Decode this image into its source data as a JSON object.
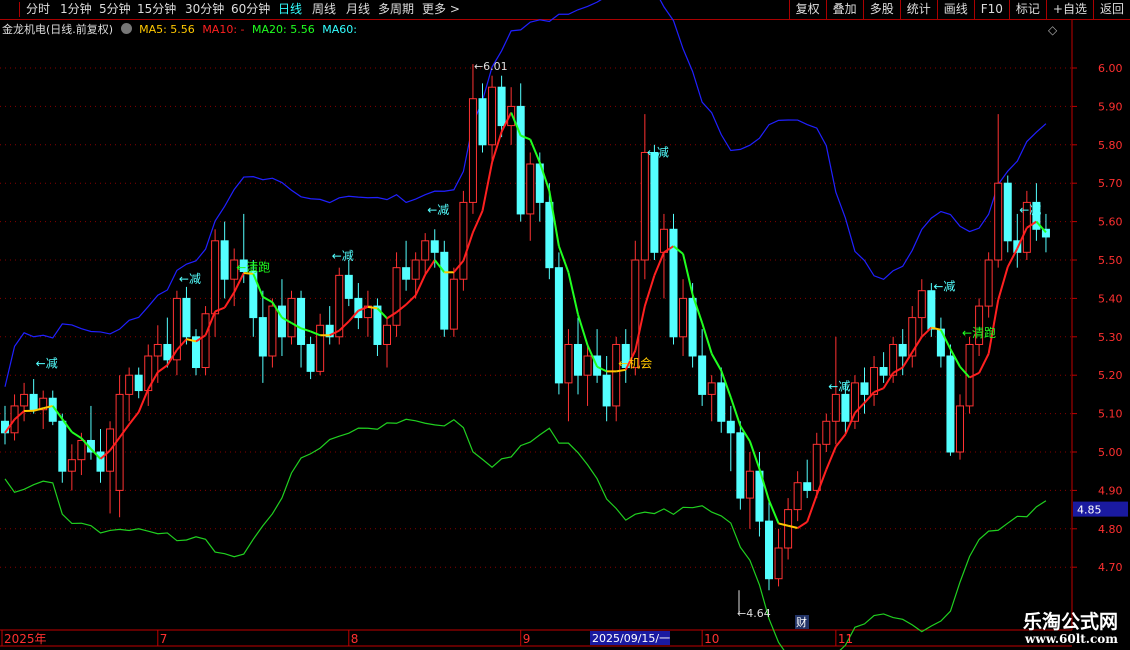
{
  "toolbar": {
    "periods": [
      "分时",
      "1分钟",
      "5分钟",
      "15分钟",
      "30分钟",
      "60分钟",
      "日线",
      "周线",
      "月线",
      "多周期",
      "更多 >"
    ],
    "active": "日线",
    "buttons": [
      "复权",
      "叠加",
      "多股",
      "统计",
      "画线",
      "F10",
      "标记",
      "+自选",
      "返回"
    ]
  },
  "legend": {
    "title": "金龙机电(日线.前复权)",
    "ma5": "MA5: 5.56",
    "ma10": "MA10: -",
    "ma20": "MA20: 5.56",
    "ma60": "MA60:"
  },
  "colors": {
    "up": "#ff3232",
    "down": "#54ffff",
    "upper_band": "#2020ff",
    "lower_band": "#20d020",
    "axis": "#c00000",
    "ma_up": "#ff2020",
    "ma_down": "#20ff20",
    "ma_flat": "#ffc800"
  },
  "chart_data": {
    "type": "candlestick",
    "ylim": [
      4.62,
      6.08
    ],
    "yticks": [
      "6.00",
      "5.90",
      "5.80",
      "5.70",
      "5.60",
      "5.50",
      "5.40",
      "5.30",
      "5.20",
      "5.10",
      "5.00",
      "4.90",
      "4.80",
      "4.70"
    ],
    "current_price": "4.85",
    "high_label": "6.01",
    "low_label": "4.64",
    "x_labels": [
      {
        "i": 0,
        "t": "2025年"
      },
      {
        "i": 16,
        "t": "7"
      },
      {
        "i": 36,
        "t": "8"
      },
      {
        "i": 54,
        "t": "9"
      },
      {
        "i": 73,
        "t": "10"
      },
      {
        "i": 87,
        "t": "11"
      }
    ],
    "cursor_date": "2025/09/15/一",
    "event_marker": "财",
    "ohlc": [
      [
        5.08,
        5.12,
        5.02,
        5.05
      ],
      [
        5.05,
        5.15,
        5.03,
        5.12
      ],
      [
        5.12,
        5.18,
        5.08,
        5.15
      ],
      [
        5.15,
        5.19,
        5.1,
        5.11
      ],
      [
        5.11,
        5.16,
        5.06,
        5.14
      ],
      [
        5.14,
        5.16,
        5.07,
        5.08
      ],
      [
        5.08,
        5.1,
        4.92,
        4.95
      ],
      [
        4.95,
        5.02,
        4.9,
        4.98
      ],
      [
        4.98,
        5.05,
        4.94,
        5.03
      ],
      [
        5.03,
        5.12,
        4.98,
        5.0
      ],
      [
        5.0,
        5.06,
        4.92,
        4.95
      ],
      [
        4.95,
        5.08,
        4.84,
        5.06
      ],
      [
        4.9,
        5.2,
        4.83,
        5.15
      ],
      [
        5.15,
        5.22,
        5.08,
        5.2
      ],
      [
        5.2,
        5.22,
        5.14,
        5.16
      ],
      [
        5.16,
        5.28,
        5.12,
        5.25
      ],
      [
        5.25,
        5.33,
        5.18,
        5.28
      ],
      [
        5.28,
        5.35,
        5.22,
        5.24
      ],
      [
        5.24,
        5.42,
        5.2,
        5.4
      ],
      [
        5.4,
        5.43,
        5.28,
        5.3
      ],
      [
        5.3,
        5.32,
        5.2,
        5.22
      ],
      [
        5.22,
        5.38,
        5.2,
        5.36
      ],
      [
        5.36,
        5.58,
        5.3,
        5.55
      ],
      [
        5.55,
        5.6,
        5.4,
        5.45
      ],
      [
        5.45,
        5.53,
        5.38,
        5.5
      ],
      [
        5.5,
        5.62,
        5.44,
        5.47
      ],
      [
        5.47,
        5.5,
        5.3,
        5.35
      ],
      [
        5.35,
        5.42,
        5.18,
        5.25
      ],
      [
        5.25,
        5.4,
        5.22,
        5.38
      ],
      [
        5.38,
        5.45,
        5.25,
        5.3
      ],
      [
        5.3,
        5.42,
        5.28,
        5.4
      ],
      [
        5.4,
        5.42,
        5.22,
        5.28
      ],
      [
        5.28,
        5.3,
        5.19,
        5.21
      ],
      [
        5.21,
        5.36,
        5.2,
        5.33
      ],
      [
        5.33,
        5.38,
        5.28,
        5.3
      ],
      [
        5.3,
        5.48,
        5.28,
        5.46
      ],
      [
        5.46,
        5.5,
        5.38,
        5.4
      ],
      [
        5.4,
        5.44,
        5.32,
        5.35
      ],
      [
        5.35,
        5.42,
        5.3,
        5.38
      ],
      [
        5.38,
        5.4,
        5.25,
        5.28
      ],
      [
        5.28,
        5.35,
        5.22,
        5.33
      ],
      [
        5.33,
        5.52,
        5.3,
        5.48
      ],
      [
        5.48,
        5.55,
        5.42,
        5.45
      ],
      [
        5.45,
        5.52,
        5.4,
        5.5
      ],
      [
        5.5,
        5.57,
        5.46,
        5.55
      ],
      [
        5.55,
        5.58,
        5.48,
        5.52
      ],
      [
        5.52,
        5.55,
        5.3,
        5.32
      ],
      [
        5.32,
        5.48,
        5.3,
        5.45
      ],
      [
        5.45,
        5.68,
        5.42,
        5.65
      ],
      [
        5.65,
        6.01,
        5.62,
        5.92
      ],
      [
        5.92,
        5.96,
        5.78,
        5.8
      ],
      [
        5.8,
        5.98,
        5.75,
        5.95
      ],
      [
        5.95,
        5.98,
        5.82,
        5.85
      ],
      [
        5.85,
        5.95,
        5.8,
        5.9
      ],
      [
        5.9,
        5.96,
        5.6,
        5.62
      ],
      [
        5.62,
        5.78,
        5.55,
        5.75
      ],
      [
        5.75,
        5.78,
        5.6,
        5.65
      ],
      [
        5.65,
        5.7,
        5.45,
        5.48
      ],
      [
        5.48,
        5.52,
        5.15,
        5.18
      ],
      [
        5.18,
        5.32,
        5.08,
        5.28
      ],
      [
        5.28,
        5.35,
        5.15,
        5.2
      ],
      [
        5.2,
        5.28,
        5.12,
        5.25
      ],
      [
        5.25,
        5.32,
        5.18,
        5.2
      ],
      [
        5.2,
        5.25,
        5.08,
        5.12
      ],
      [
        5.12,
        5.3,
        5.08,
        5.28
      ],
      [
        5.28,
        5.32,
        5.18,
        5.22
      ],
      [
        5.22,
        5.55,
        5.2,
        5.5
      ],
      [
        5.5,
        5.88,
        5.45,
        5.78
      ],
      [
        5.78,
        5.8,
        5.5,
        5.52
      ],
      [
        5.52,
        5.62,
        5.4,
        5.58
      ],
      [
        5.58,
        5.62,
        5.28,
        5.3
      ],
      [
        5.3,
        5.45,
        5.25,
        5.4
      ],
      [
        5.4,
        5.44,
        5.22,
        5.25
      ],
      [
        5.25,
        5.32,
        5.12,
        5.15
      ],
      [
        5.15,
        5.2,
        5.08,
        5.18
      ],
      [
        5.18,
        5.22,
        5.05,
        5.08
      ],
      [
        5.08,
        5.12,
        4.95,
        5.05
      ],
      [
        5.05,
        5.08,
        4.85,
        4.88
      ],
      [
        4.88,
        5.0,
        4.8,
        4.95
      ],
      [
        4.95,
        5.0,
        4.78,
        4.82
      ],
      [
        4.82,
        4.88,
        4.64,
        4.67
      ],
      [
        4.67,
        4.8,
        4.65,
        4.75
      ],
      [
        4.75,
        4.88,
        4.72,
        4.85
      ],
      [
        4.85,
        4.95,
        4.82,
        4.92
      ],
      [
        4.92,
        4.98,
        4.88,
        4.9
      ],
      [
        4.9,
        5.05,
        4.88,
        5.02
      ],
      [
        5.02,
        5.1,
        5.0,
        5.08
      ],
      [
        5.08,
        5.3,
        5.02,
        5.15
      ],
      [
        5.15,
        5.18,
        5.05,
        5.08
      ],
      [
        5.08,
        5.2,
        5.06,
        5.18
      ],
      [
        5.18,
        5.22,
        5.1,
        5.15
      ],
      [
        5.15,
        5.25,
        5.12,
        5.22
      ],
      [
        5.22,
        5.26,
        5.18,
        5.2
      ],
      [
        5.2,
        5.3,
        5.18,
        5.28
      ],
      [
        5.28,
        5.32,
        5.2,
        5.25
      ],
      [
        5.25,
        5.38,
        5.22,
        5.35
      ],
      [
        5.35,
        5.45,
        5.3,
        5.42
      ],
      [
        5.42,
        5.44,
        5.3,
        5.32
      ],
      [
        5.32,
        5.35,
        5.22,
        5.25
      ],
      [
        5.25,
        5.28,
        4.99,
        5.0
      ],
      [
        5.0,
        5.15,
        4.98,
        5.12
      ],
      [
        5.12,
        5.3,
        5.1,
        5.28
      ],
      [
        5.28,
        5.4,
        5.25,
        5.38
      ],
      [
        5.38,
        5.52,
        5.35,
        5.5
      ],
      [
        5.5,
        5.88,
        5.48,
        5.7
      ],
      [
        5.7,
        5.72,
        5.52,
        5.55
      ],
      [
        5.55,
        5.62,
        5.48,
        5.52
      ],
      [
        5.52,
        5.68,
        5.5,
        5.65
      ],
      [
        5.65,
        5.7,
        5.55,
        5.58
      ],
      [
        5.58,
        5.62,
        5.52,
        5.56
      ]
    ],
    "signals": [
      {
        "i": 3,
        "t": "←减",
        "c": "#54ffff",
        "p": 5.22
      },
      {
        "i": 18,
        "t": "←减",
        "c": "#54ffff",
        "p": 5.44
      },
      {
        "i": 24,
        "t": "←清跑",
        "c": "#20ff20",
        "p": 5.47
      },
      {
        "i": 34,
        "t": "←减",
        "c": "#54ffff",
        "p": 5.5
      },
      {
        "i": 44,
        "t": "←减",
        "c": "#54ffff",
        "p": 5.62
      },
      {
        "i": 64,
        "t": "←机会",
        "c": "#ffc800",
        "p": 5.22
      },
      {
        "i": 67,
        "t": "←减",
        "c": "#54ffff",
        "p": 5.77
      },
      {
        "i": 86,
        "t": "←减",
        "c": "#54ffff",
        "p": 5.16
      },
      {
        "i": 97,
        "t": "←减",
        "c": "#54ffff",
        "p": 5.42
      },
      {
        "i": 100,
        "t": "←清跑",
        "c": "#20ff20",
        "p": 5.3
      },
      {
        "i": 106,
        "t": "←减",
        "c": "#54ffff",
        "p": 5.62
      }
    ]
  },
  "watermark": {
    "name": "乐淘公式网",
    "url": "www.60lt.com"
  }
}
